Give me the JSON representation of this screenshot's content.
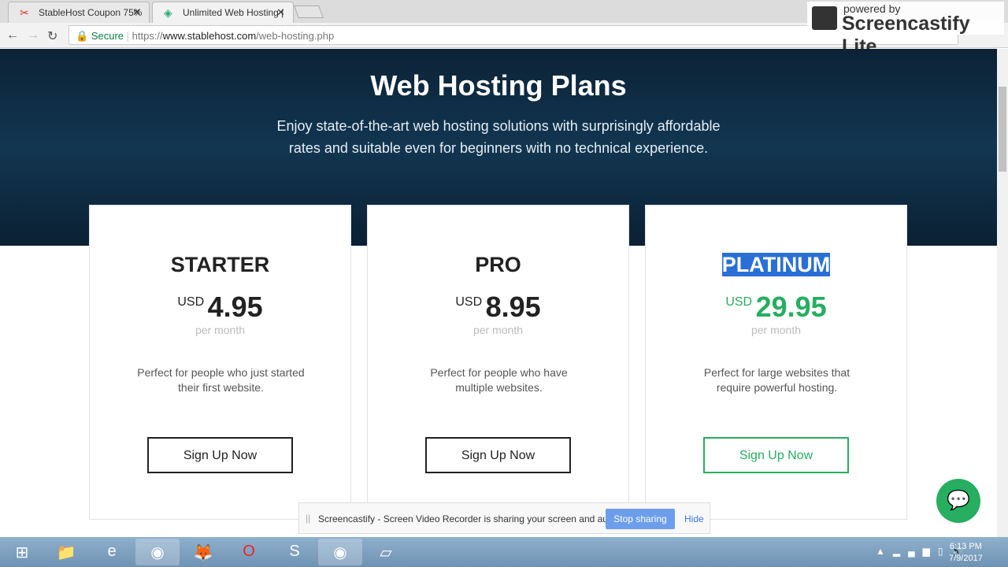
{
  "browser": {
    "tabs": [
      {
        "title": "StableHost Coupon 75%",
        "active": false
      },
      {
        "title": "Unlimited Web Hosting |",
        "active": true
      }
    ],
    "secure_label": "Secure",
    "url_scheme": "https://",
    "url_host": "www.stablehost.com",
    "url_path": "/web-hosting.php"
  },
  "overlay": {
    "powered_by": "powered by",
    "brand": "Screencastify Lite"
  },
  "hero": {
    "title": "Web Hosting Plans",
    "subtitle": "Enjoy state-of-the-art web hosting solutions with surprisingly affordable rates and suitable even for beginners with no technical experience."
  },
  "plans": [
    {
      "name": "STARTER",
      "currency": "USD",
      "price": "4.95",
      "period": "per month",
      "description": "Perfect for people who just started their first website.",
      "button": "Sign Up Now"
    },
    {
      "name": "PRO",
      "currency": "USD",
      "price": "8.95",
      "period": "per month",
      "description": "Perfect for people who have multiple websites.",
      "button": "Sign Up Now"
    },
    {
      "name": "PLATINUM",
      "currency": "USD",
      "price": "29.95",
      "period": "per month",
      "description": "Perfect for large websites that require powerful hosting.",
      "button": "Sign Up Now",
      "highlighted": true
    }
  ],
  "share_bar": {
    "message": "Screencastify - Screen Video Recorder is sharing your screen and audio.",
    "stop": "Stop sharing",
    "hide": "Hide"
  },
  "taskbar": {
    "time": "6:13 PM",
    "date": "7/9/2017"
  },
  "colors": {
    "accent_green": "#27ae60",
    "hero_bg": "#123651",
    "selection": "#2a6fd6"
  }
}
